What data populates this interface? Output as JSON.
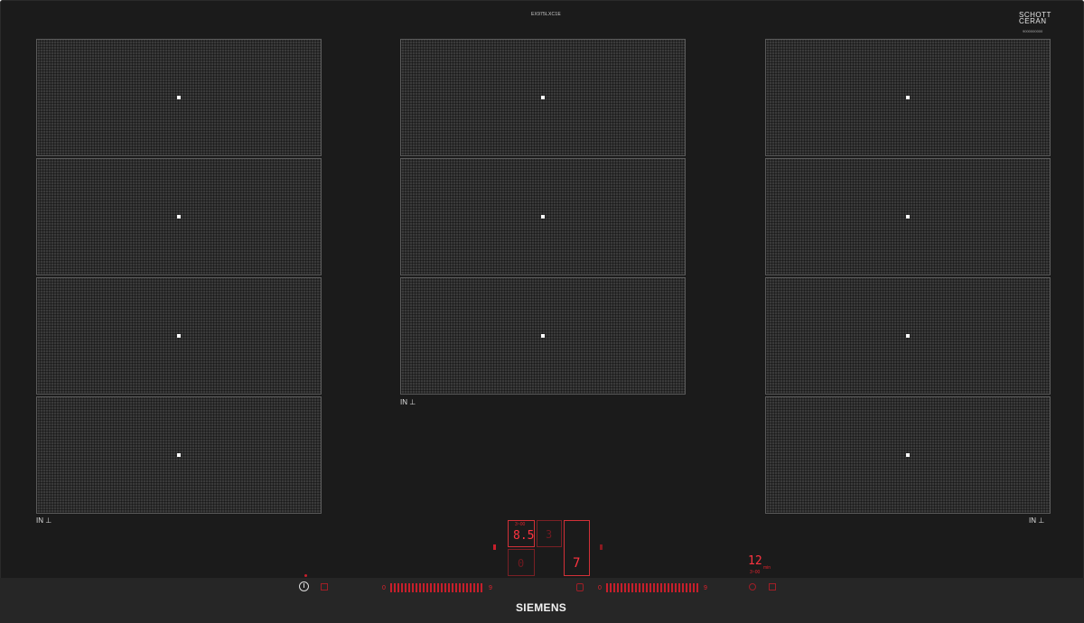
{
  "header": {
    "model": "EX975LXC1E",
    "brand_top": "SCHOTT\nCERAN",
    "brand_sub": "9000000000"
  },
  "zones": {
    "induction_label": "IN"
  },
  "display": {
    "timer_small": "3~00",
    "main_value": "8.5",
    "second_value": "3",
    "zero_value": "0",
    "seven_value": "7",
    "minutes_value": "12",
    "minutes_unit": "min",
    "minutes_sub": "3~00",
    "left_slider_start": "0",
    "left_slider_end": "9",
    "right_slider_start": "0",
    "right_slider_end": "9"
  },
  "footer": {
    "brand": "SIEMENS"
  },
  "colors": {
    "glass": "#1b1b1b",
    "zone": "#3a3a3a",
    "led": "#e0222d"
  }
}
